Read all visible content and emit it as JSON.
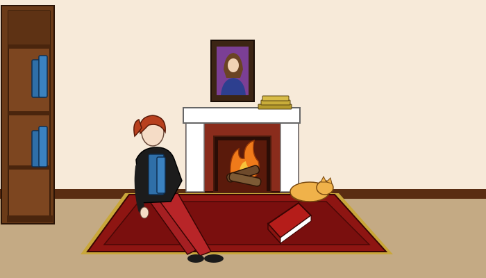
{
  "scene": {
    "type": "room",
    "colors": {
      "wall": "#f7ead9",
      "floor": "#c4aa84",
      "baseboard": "#5a2d12",
      "rug": "#8e1512",
      "rug_inner": "#7a0f0e",
      "fringe": "#c9a73a",
      "bookshelf": "#6b3b18",
      "fireplace_brick": "#8a2c1c",
      "mantel": "#ffffff",
      "flame": "#f07a1a",
      "book_blue": "#2f6fa8",
      "book_red": "#b51d1a",
      "cat": "#f0b24a",
      "hair": "#b8401e"
    },
    "objects": [
      {
        "name": "bookshelf",
        "icon": "bookshelf-icon"
      },
      {
        "name": "shelf-book-upper",
        "icon": "book-icon"
      },
      {
        "name": "shelf-book-lower",
        "icon": "book-icon"
      },
      {
        "name": "portrait-painting",
        "icon": "painting-icon"
      },
      {
        "name": "mantel-book-stack",
        "icon": "books-icon"
      },
      {
        "name": "fireplace",
        "icon": "fireplace-icon"
      },
      {
        "name": "fire",
        "icon": "flame-icon"
      },
      {
        "name": "rug",
        "icon": "rug-icon"
      },
      {
        "name": "girl-character",
        "icon": "person-icon"
      },
      {
        "name": "held-blue-book",
        "icon": "book-icon"
      },
      {
        "name": "red-book-on-rug",
        "icon": "book-icon"
      },
      {
        "name": "sleeping-cat",
        "icon": "cat-icon"
      }
    ]
  }
}
